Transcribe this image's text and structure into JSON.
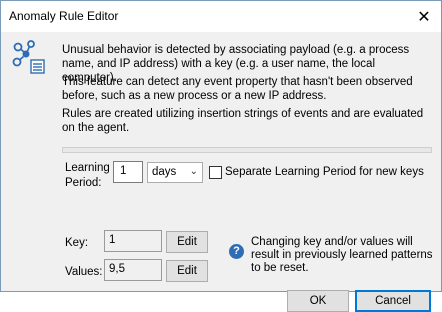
{
  "window": {
    "title": "Anomaly Rule Editor",
    "close_glyph": "✕"
  },
  "description": {
    "para1": "Unusual behavior is detected by associating payload (e.g. a process name, and IP address) with a key (e.g. a user name, the local computer).",
    "para2": "This feature can detect any event property that hasn't been observed before, such as a new process or a new IP address.",
    "para3": "Rules are created utilizing insertion strings of events and are evaluated on the agent."
  },
  "learning_period": {
    "label_line1": "Learning",
    "label_line2": "Period:",
    "value": "1",
    "unit": "days",
    "separate_label": "Separate Learning Period for new keys",
    "separate_checked": false
  },
  "key": {
    "label": "Key:",
    "value": "1",
    "edit_label": "Edit"
  },
  "values": {
    "label": "Values:",
    "value": "9,5",
    "edit_label": "Edit"
  },
  "help": {
    "icon_glyph": "?",
    "text": "Changing key and/or values will result in previously learned patterns to be reset."
  },
  "buttons": {
    "ok": "OK",
    "cancel": "Cancel"
  },
  "icons": {
    "app": "network-rules-icon",
    "help": "question-icon",
    "close": "close-icon",
    "dropdown": "chevron-down-icon"
  },
  "colors": {
    "accent": "#0078d7",
    "help_icon": "#2e6db4"
  }
}
